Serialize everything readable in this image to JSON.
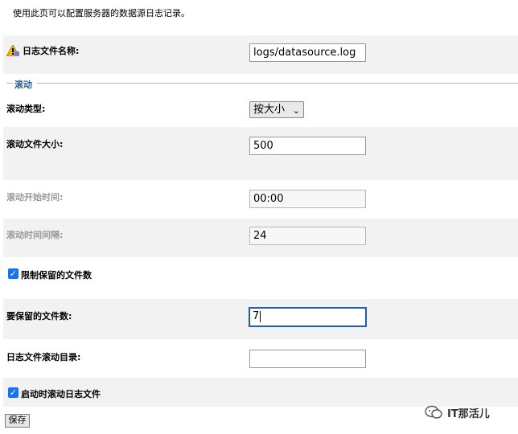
{
  "intro": "使用此页可以配置服务器的数据源日志记录。",
  "log_file_name": {
    "label": "日志文件名称:",
    "value": "logs/datasource.log"
  },
  "rotation_section": {
    "legend": "滚动"
  },
  "rotation_type": {
    "label": "滚动类型:",
    "selected": "按大小"
  },
  "rotation_file_size": {
    "label": "滚动文件大小:",
    "value": "500"
  },
  "rotation_start_time": {
    "label": "滚动开始时间:",
    "value": "00:00"
  },
  "rotation_interval": {
    "label": "滚动时间间隔:",
    "value": "24"
  },
  "limit_retained": {
    "label": "限制保留的文件数",
    "checked": true
  },
  "files_to_retain": {
    "label": "要保留的文件数:",
    "value": "7"
  },
  "rotation_dir": {
    "label": "日志文件滚动目录:",
    "value": ""
  },
  "rotate_on_startup": {
    "label": "启动时滚动日志文件",
    "checked": true
  },
  "save_button": "保存",
  "watermark": "IT那活儿",
  "colors": {
    "accent": "#1a73e8",
    "focus": "#1e5fb4",
    "legend": "#2f5f8a",
    "row_shade": "#f2f2f2"
  },
  "icons": {
    "warning": "warning-lock-icon",
    "checkbox": "check-icon",
    "dropdown": "chevron-down-icon",
    "watermark": "wechat-icon"
  }
}
